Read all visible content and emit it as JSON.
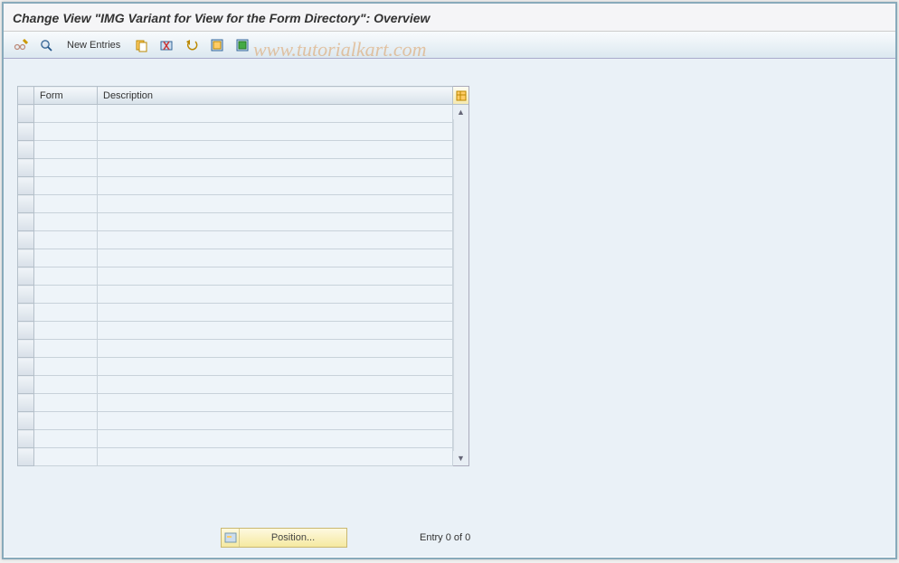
{
  "title": "Change View \"IMG Variant for View for the Form Directory\": Overview",
  "watermark": "www.tutorialkart.com",
  "toolbar": {
    "new_entries_label": "New Entries",
    "icons": {
      "toggle": "toggle-icon",
      "detail": "detail-icon",
      "copy": "copy-icon",
      "delete": "delete-icon",
      "undo": "undo-icon",
      "select_all": "select-all-icon",
      "deselect_all": "deselect-all-icon"
    }
  },
  "table": {
    "columns": [
      "Form",
      "Description"
    ],
    "rows": [
      {
        "form": "",
        "description": ""
      },
      {
        "form": "",
        "description": ""
      },
      {
        "form": "",
        "description": ""
      },
      {
        "form": "",
        "description": ""
      },
      {
        "form": "",
        "description": ""
      },
      {
        "form": "",
        "description": ""
      },
      {
        "form": "",
        "description": ""
      },
      {
        "form": "",
        "description": ""
      },
      {
        "form": "",
        "description": ""
      },
      {
        "form": "",
        "description": ""
      },
      {
        "form": "",
        "description": ""
      },
      {
        "form": "",
        "description": ""
      },
      {
        "form": "",
        "description": ""
      },
      {
        "form": "",
        "description": ""
      },
      {
        "form": "",
        "description": ""
      },
      {
        "form": "",
        "description": ""
      },
      {
        "form": "",
        "description": ""
      },
      {
        "form": "",
        "description": ""
      },
      {
        "form": "",
        "description": ""
      },
      {
        "form": "",
        "description": ""
      }
    ]
  },
  "footer": {
    "position_label": "Position...",
    "entry_status": "Entry 0 of 0"
  }
}
